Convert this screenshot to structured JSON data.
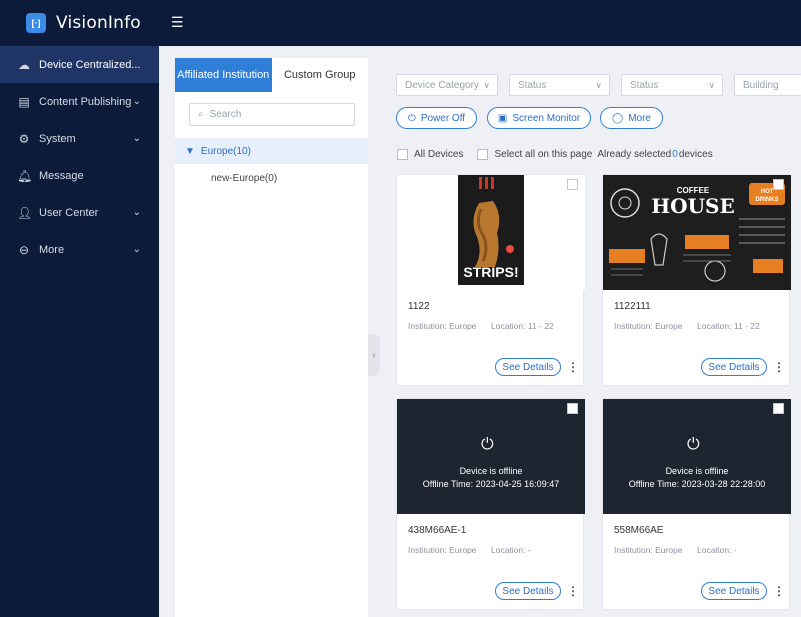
{
  "app": {
    "title": "VisionInfo",
    "logo_glyph": "[·]"
  },
  "sidebar": {
    "items": [
      {
        "label": "Device Centralized...",
        "icon": "cloud-dashboard-icon",
        "active": true
      },
      {
        "label": "Content Publishing",
        "icon": "publishing-icon"
      },
      {
        "label": "System",
        "icon": "gear-icon"
      },
      {
        "label": "Message",
        "icon": "bell-icon"
      },
      {
        "label": "User Center",
        "icon": "user-icon"
      },
      {
        "label": "More",
        "icon": "more-icon"
      }
    ]
  },
  "tree": {
    "tabs": [
      {
        "label": "Affiliated Institution",
        "active": true
      },
      {
        "label": "Custom Group"
      }
    ],
    "search_placeholder": "Search",
    "root": "Europe(10)",
    "child": "new-Europe(0)"
  },
  "filters": {
    "device_category": "Device Category",
    "status1": "Status",
    "status2": "Status",
    "building": "Building"
  },
  "actions": {
    "power_off": "Power Off",
    "screen_monitor": "Screen Monitor",
    "more": "More"
  },
  "selection": {
    "all_devices": "All Devices",
    "select_page": "Select all on this page",
    "already_prefix": "Already selected",
    "count": "0",
    "suffix": "devices"
  },
  "devices": [
    {
      "name": "1122",
      "institution": "Institution: Europe",
      "location": "Location: 11 - 22",
      "thumb_text": "STRIPS!",
      "details": "See Details"
    },
    {
      "name": "1122111",
      "institution": "Institution: Europe",
      "location": "Location: 11 - 22",
      "thumb_title": "COFFEE HOUSE",
      "thumb_sub": "HOT DRINKS",
      "details": "See Details"
    },
    {
      "name": "438M66AE-1",
      "institution": "Institution: Europe",
      "location": "Location: -",
      "status": "Device is offline",
      "offline_time": "Offline Time: 2023-04-25 16:09:47",
      "details": "See Details"
    },
    {
      "name": "558M66AE",
      "institution": "Institution: Europe",
      "location": "Location: -",
      "status": "Device is offline",
      "offline_time": "Offline Time: 2023-03-28 22:28:00",
      "details": "See Details"
    }
  ],
  "colors": {
    "nav_bg": "#0d1b3a",
    "accent": "#2f7fd8",
    "active_nav": "#1e3566"
  }
}
